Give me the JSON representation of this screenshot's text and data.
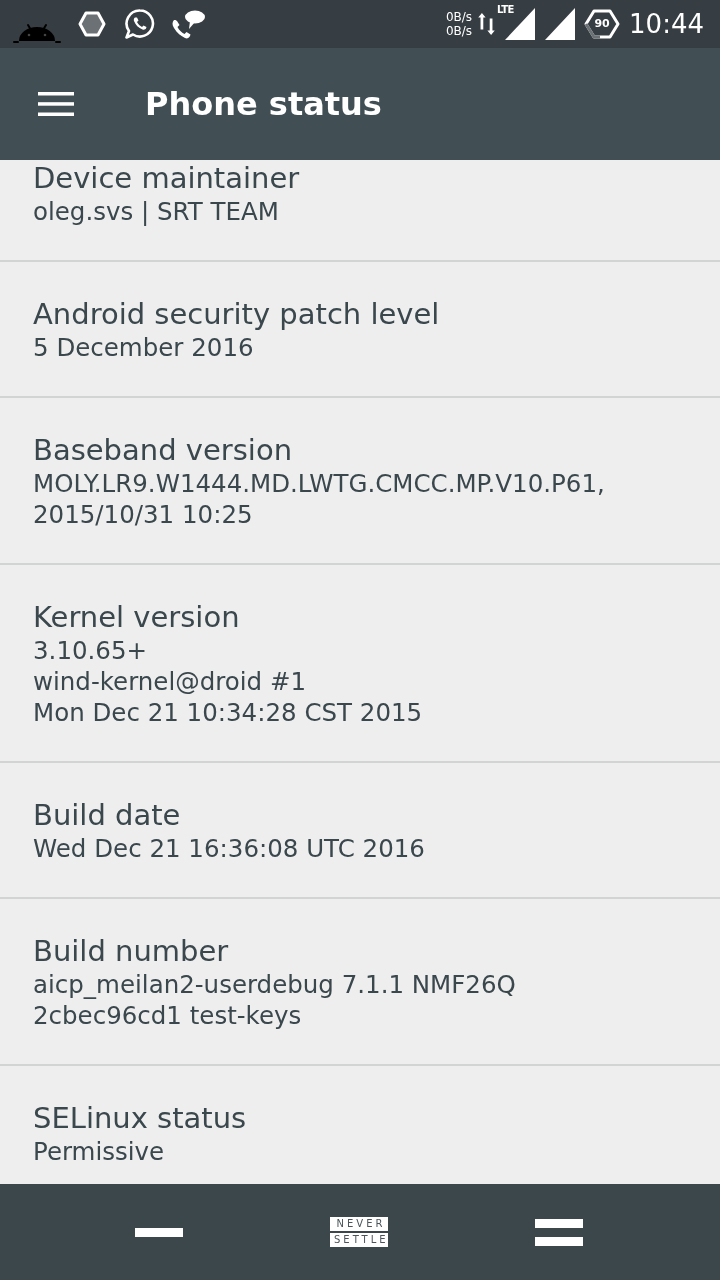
{
  "status_bar": {
    "net_speed": [
      "0B/s",
      "0B/s"
    ],
    "network_label": "LTE",
    "battery": "90",
    "time": "10:44"
  },
  "app_bar": {
    "title": "Phone status"
  },
  "items": [
    {
      "title": "Device maintainer",
      "value": "oleg.svs | SRT TEAM"
    },
    {
      "title": "Android security patch level",
      "value": "5 December 2016"
    },
    {
      "title": "Baseband version",
      "value": "MOLY.LR9.W1444.MD.LWTG.CMCC.MP.V10.P61,\n2015/10/31 10:25"
    },
    {
      "title": "Kernel version",
      "value": "3.10.65+\nwind-kernel@droid #1\nMon Dec 21 10:34:28 CST 2015"
    },
    {
      "title": "Build date",
      "value": "Wed Dec 21 16:36:08 UTC 2016"
    },
    {
      "title": "Build number",
      "value": "aicp_meilan2-userdebug 7.1.1 NMF26Q\n2cbec96cd1 test-keys"
    },
    {
      "title": "SELinux status",
      "value": "Permissive"
    }
  ],
  "nav_bar": {
    "home_logo": [
      "NEVER",
      "SETTLE"
    ]
  }
}
